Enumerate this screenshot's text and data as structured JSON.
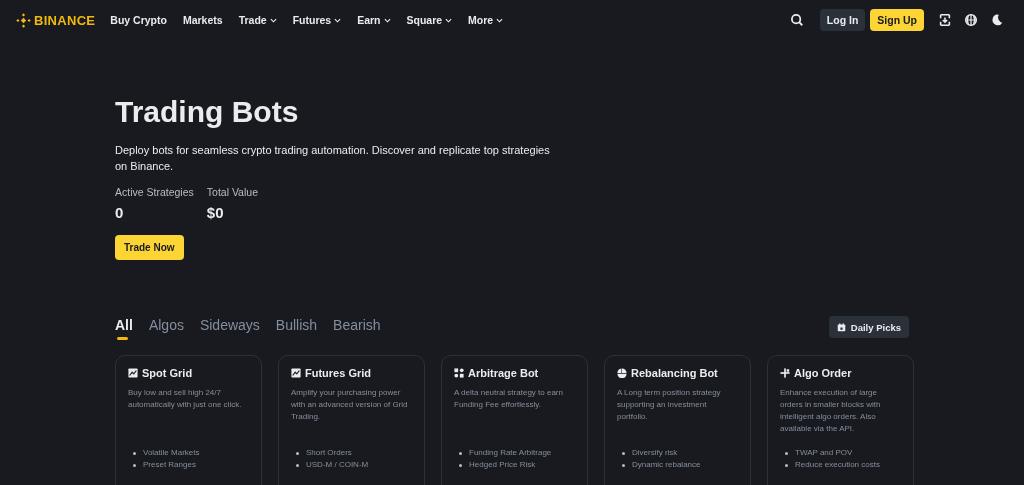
{
  "brand": {
    "name": "BINANCE"
  },
  "nav": [
    {
      "label": "Buy Crypto",
      "has_menu": false
    },
    {
      "label": "Markets",
      "has_menu": false
    },
    {
      "label": "Trade",
      "has_menu": true
    },
    {
      "label": "Futures",
      "has_menu": true
    },
    {
      "label": "Earn",
      "has_menu": true
    },
    {
      "label": "Square",
      "has_menu": true
    },
    {
      "label": "More",
      "has_menu": true
    }
  ],
  "actions": {
    "login": "Log In",
    "signup": "Sign Up"
  },
  "hero": {
    "title": "Trading Bots",
    "description": "Deploy bots for seamless crypto trading automation. Discover and replicate top strategies on Binance.",
    "stats": [
      {
        "label": "Active Strategies",
        "value": "0"
      },
      {
        "label": "Total Value",
        "value": "$0"
      }
    ],
    "button": "Trade Now"
  },
  "tabs": [
    {
      "label": "All",
      "selected": true
    },
    {
      "label": "Algos",
      "selected": false
    },
    {
      "label": "Sideways",
      "selected": false
    },
    {
      "label": "Bullish",
      "selected": false
    },
    {
      "label": "Bearish",
      "selected": false
    }
  ],
  "daily_picks": "Daily Picks",
  "cards": [
    {
      "title": "Spot Grid",
      "description": "Buy low and sell high 24/7 automatically with just one click.",
      "features": [
        "Volatile Markets",
        "Preset Ranges"
      ]
    },
    {
      "title": "Futures Grid",
      "description": "Amplify your purchasing power with an advanced version of Grid Trading.",
      "features": [
        "Short Orders",
        "USD-M / COIN-M"
      ]
    },
    {
      "title": "Arbitrage Bot",
      "description": "A delta neutral strategy to earn Funding Fee effortlessly.",
      "features": [
        "Funding Rate Arbitrage",
        "Hedged Price Risk"
      ]
    },
    {
      "title": "Rebalancing Bot",
      "description": "A Long term position strategy supporting an investment portfolio.",
      "features": [
        "Diversify risk",
        "Dynamic rebalance"
      ]
    },
    {
      "title": "Algo Order",
      "description": "Enhance execution of large orders in smaller blocks with intelligent algo orders. Also available via the API.",
      "features": [
        "TWAP and POV",
        "Reduce execution costs"
      ]
    }
  ]
}
